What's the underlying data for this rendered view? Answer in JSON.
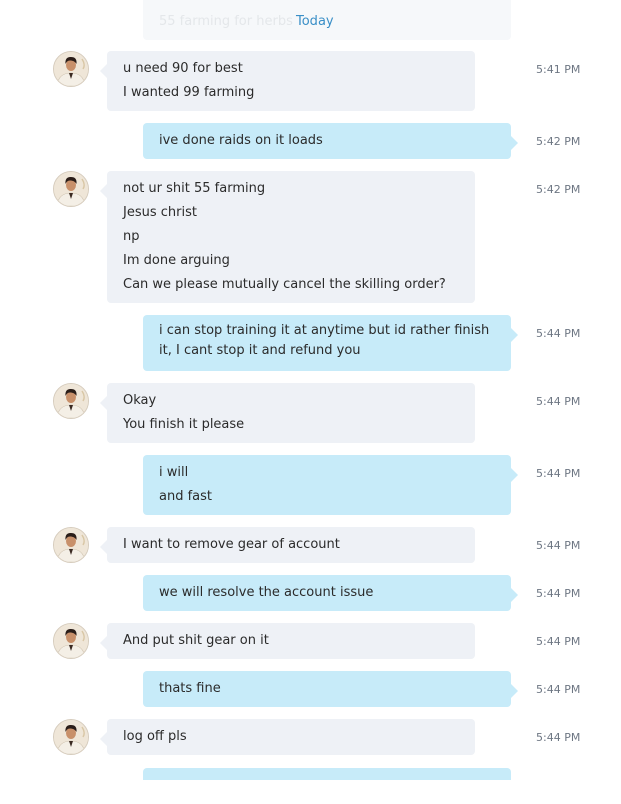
{
  "header": {
    "faded_text": "55 farming for herbs",
    "date_label": "Today"
  },
  "colors": {
    "received_bubble": "#eef1f6",
    "sent_bubble": "#c7ebf9",
    "today_link": "#3a8fc7",
    "timestamp": "#6d7683"
  },
  "messages": [
    {
      "sender": "contact",
      "time": "5:41 PM",
      "lines": [
        "u need 90 for best",
        "I wanted 99 farming"
      ]
    },
    {
      "sender": "me",
      "time": "5:42 PM",
      "lines": [
        "ive done raids on it loads"
      ]
    },
    {
      "sender": "contact",
      "time": "5:42 PM",
      "lines": [
        "not ur shit 55 farming",
        "Jesus christ",
        "np",
        "Im done arguing",
        "Can we please mutually cancel the skilling order?"
      ]
    },
    {
      "sender": "me",
      "time": "5:44 PM",
      "lines": [
        "i can stop training it at anytime but id rather finish it, I cant stop it and refund you"
      ]
    },
    {
      "sender": "contact",
      "time": "5:44 PM",
      "lines": [
        "Okay",
        "You finish it please"
      ]
    },
    {
      "sender": "me",
      "time": "5:44 PM",
      "lines": [
        "i will",
        "and fast"
      ]
    },
    {
      "sender": "contact",
      "time": "5:44 PM",
      "lines": [
        "I want to remove gear of account"
      ]
    },
    {
      "sender": "me",
      "time": "5:44 PM",
      "lines": [
        "we will resolve the account issue"
      ]
    },
    {
      "sender": "contact",
      "time": "5:44 PM",
      "lines": [
        "And put shit gear on it"
      ]
    },
    {
      "sender": "me",
      "time": "5:44 PM",
      "lines": [
        "thats fine"
      ]
    },
    {
      "sender": "contact",
      "time": "5:44 PM",
      "lines": [
        "log off pls"
      ]
    }
  ]
}
